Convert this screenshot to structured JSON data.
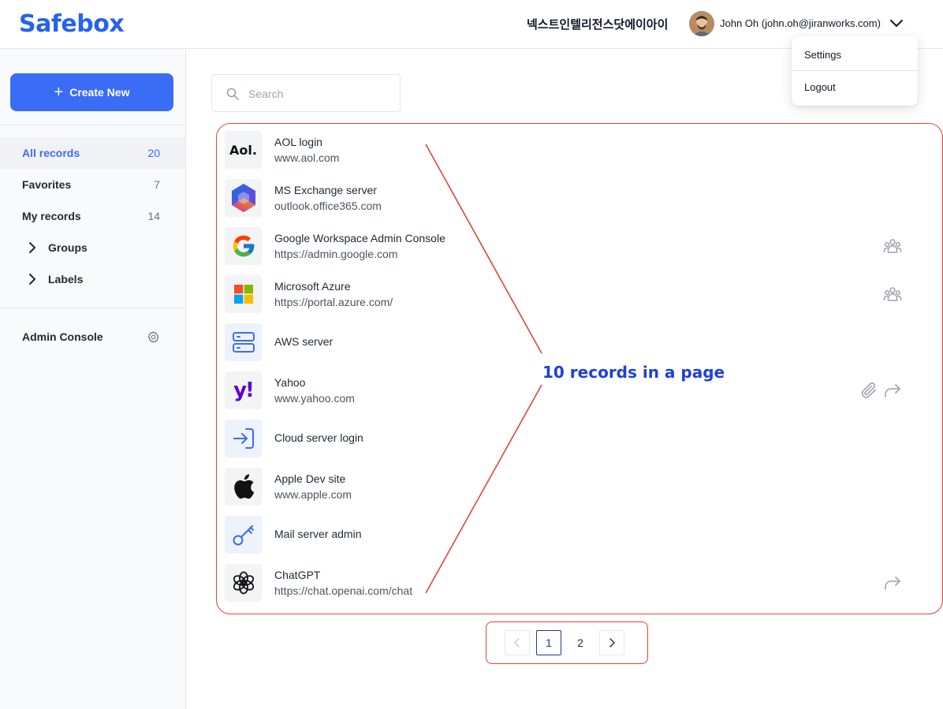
{
  "header": {
    "logo": "Safebox",
    "company": "넥스트인텔리전스닷에이아이",
    "user": "John Oh  (john.oh@jiranworks.com)"
  },
  "user_menu": {
    "items": [
      {
        "label": "Settings"
      },
      {
        "label": "Logout"
      }
    ]
  },
  "sidebar": {
    "create_label": "Create New",
    "nav": [
      {
        "label": "All records",
        "count": "20"
      },
      {
        "label": "Favorites",
        "count": "7"
      },
      {
        "label": "My records",
        "count": "14"
      },
      {
        "label": "Groups"
      },
      {
        "label": "Labels"
      }
    ],
    "admin_label": "Admin Console"
  },
  "search": {
    "placeholder": "Search",
    "value": ""
  },
  "records": [
    {
      "title": "AOL login",
      "url": "www.aol.com",
      "icon": "aol-logo-icon"
    },
    {
      "title": "MS Exchange server",
      "url": "outlook.office365.com",
      "icon": "microsoft-365-icon"
    },
    {
      "title": "Google Workspace Admin Console",
      "url": "https://admin.google.com",
      "icon": "google-icon",
      "actions": [
        "shared-group-icon"
      ]
    },
    {
      "title": "Microsoft Azure",
      "url": "https://portal.azure.com/",
      "icon": "microsoft-icon",
      "actions": [
        "shared-group-icon"
      ]
    },
    {
      "title": "AWS server",
      "url": "",
      "icon": "server-icon"
    },
    {
      "title": "Yahoo",
      "url": "www.yahoo.com",
      "icon": "yahoo-icon",
      "actions": [
        "attachment-icon",
        "share-icon"
      ]
    },
    {
      "title": "Cloud server login",
      "url": "",
      "icon": "login-icon"
    },
    {
      "title": "Apple Dev site",
      "url": "www.apple.com",
      "icon": "apple-icon"
    },
    {
      "title": "Mail server admin",
      "url": "",
      "icon": "key-icon"
    },
    {
      "title": "ChatGPT",
      "url": "https://chat.openai.com/chat",
      "icon": "openai-icon",
      "actions": [
        "share-icon"
      ]
    }
  ],
  "annotation": {
    "text": "10 records in a page"
  },
  "pagination": {
    "pages": [
      "1",
      "2"
    ],
    "current": "1"
  },
  "colors": {
    "accent": "#3b6cf6",
    "annotation_red": "#e0453a",
    "annotation_blue": "#1d3fe0"
  }
}
